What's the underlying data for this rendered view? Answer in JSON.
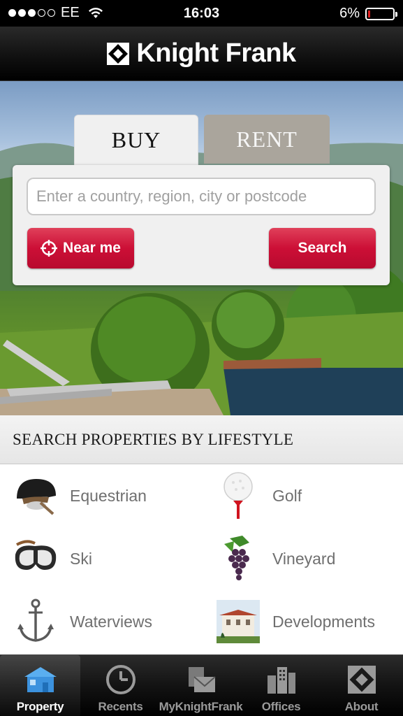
{
  "status_bar": {
    "carrier": "EE",
    "time": "16:03",
    "battery": "6%",
    "battery_level": 0.06,
    "signal_bars_filled": 3,
    "signal_bars_total": 5
  },
  "header": {
    "brand": "Knight Frank",
    "logo_icon": "knight-frank-logo-icon"
  },
  "search": {
    "tabs": [
      {
        "label": "BUY",
        "active": true
      },
      {
        "label": "RENT",
        "active": false
      }
    ],
    "placeholder": "Enter a country, region, city or postcode",
    "near_me_label": "Near me",
    "search_label": "Search"
  },
  "lifestyle": {
    "title": "SEARCH PROPERTIES BY LIFESTYLE",
    "items": [
      {
        "label": "Equestrian",
        "icon": "riding-helmet-icon"
      },
      {
        "label": "Golf",
        "icon": "golf-ball-icon"
      },
      {
        "label": "Ski",
        "icon": "ski-goggles-icon"
      },
      {
        "label": "Vineyard",
        "icon": "grapes-icon"
      },
      {
        "label": "Waterviews",
        "icon": "anchor-icon"
      },
      {
        "label": "Developments",
        "icon": "villa-icon"
      }
    ]
  },
  "tab_bar": {
    "items": [
      {
        "label": "Property",
        "icon": "house-icon",
        "active": true
      },
      {
        "label": "Recents",
        "icon": "clock-icon",
        "active": false
      },
      {
        "label": "MyKnightFrank",
        "icon": "mail-folder-icon",
        "active": false
      },
      {
        "label": "Offices",
        "icon": "buildings-icon",
        "active": false
      },
      {
        "label": "About",
        "icon": "knight-frank-logo-icon",
        "active": false
      }
    ]
  },
  "colors": {
    "accent_red": "#cc0f36",
    "header_black": "#000000",
    "rent_tab": "#aaa59c"
  }
}
